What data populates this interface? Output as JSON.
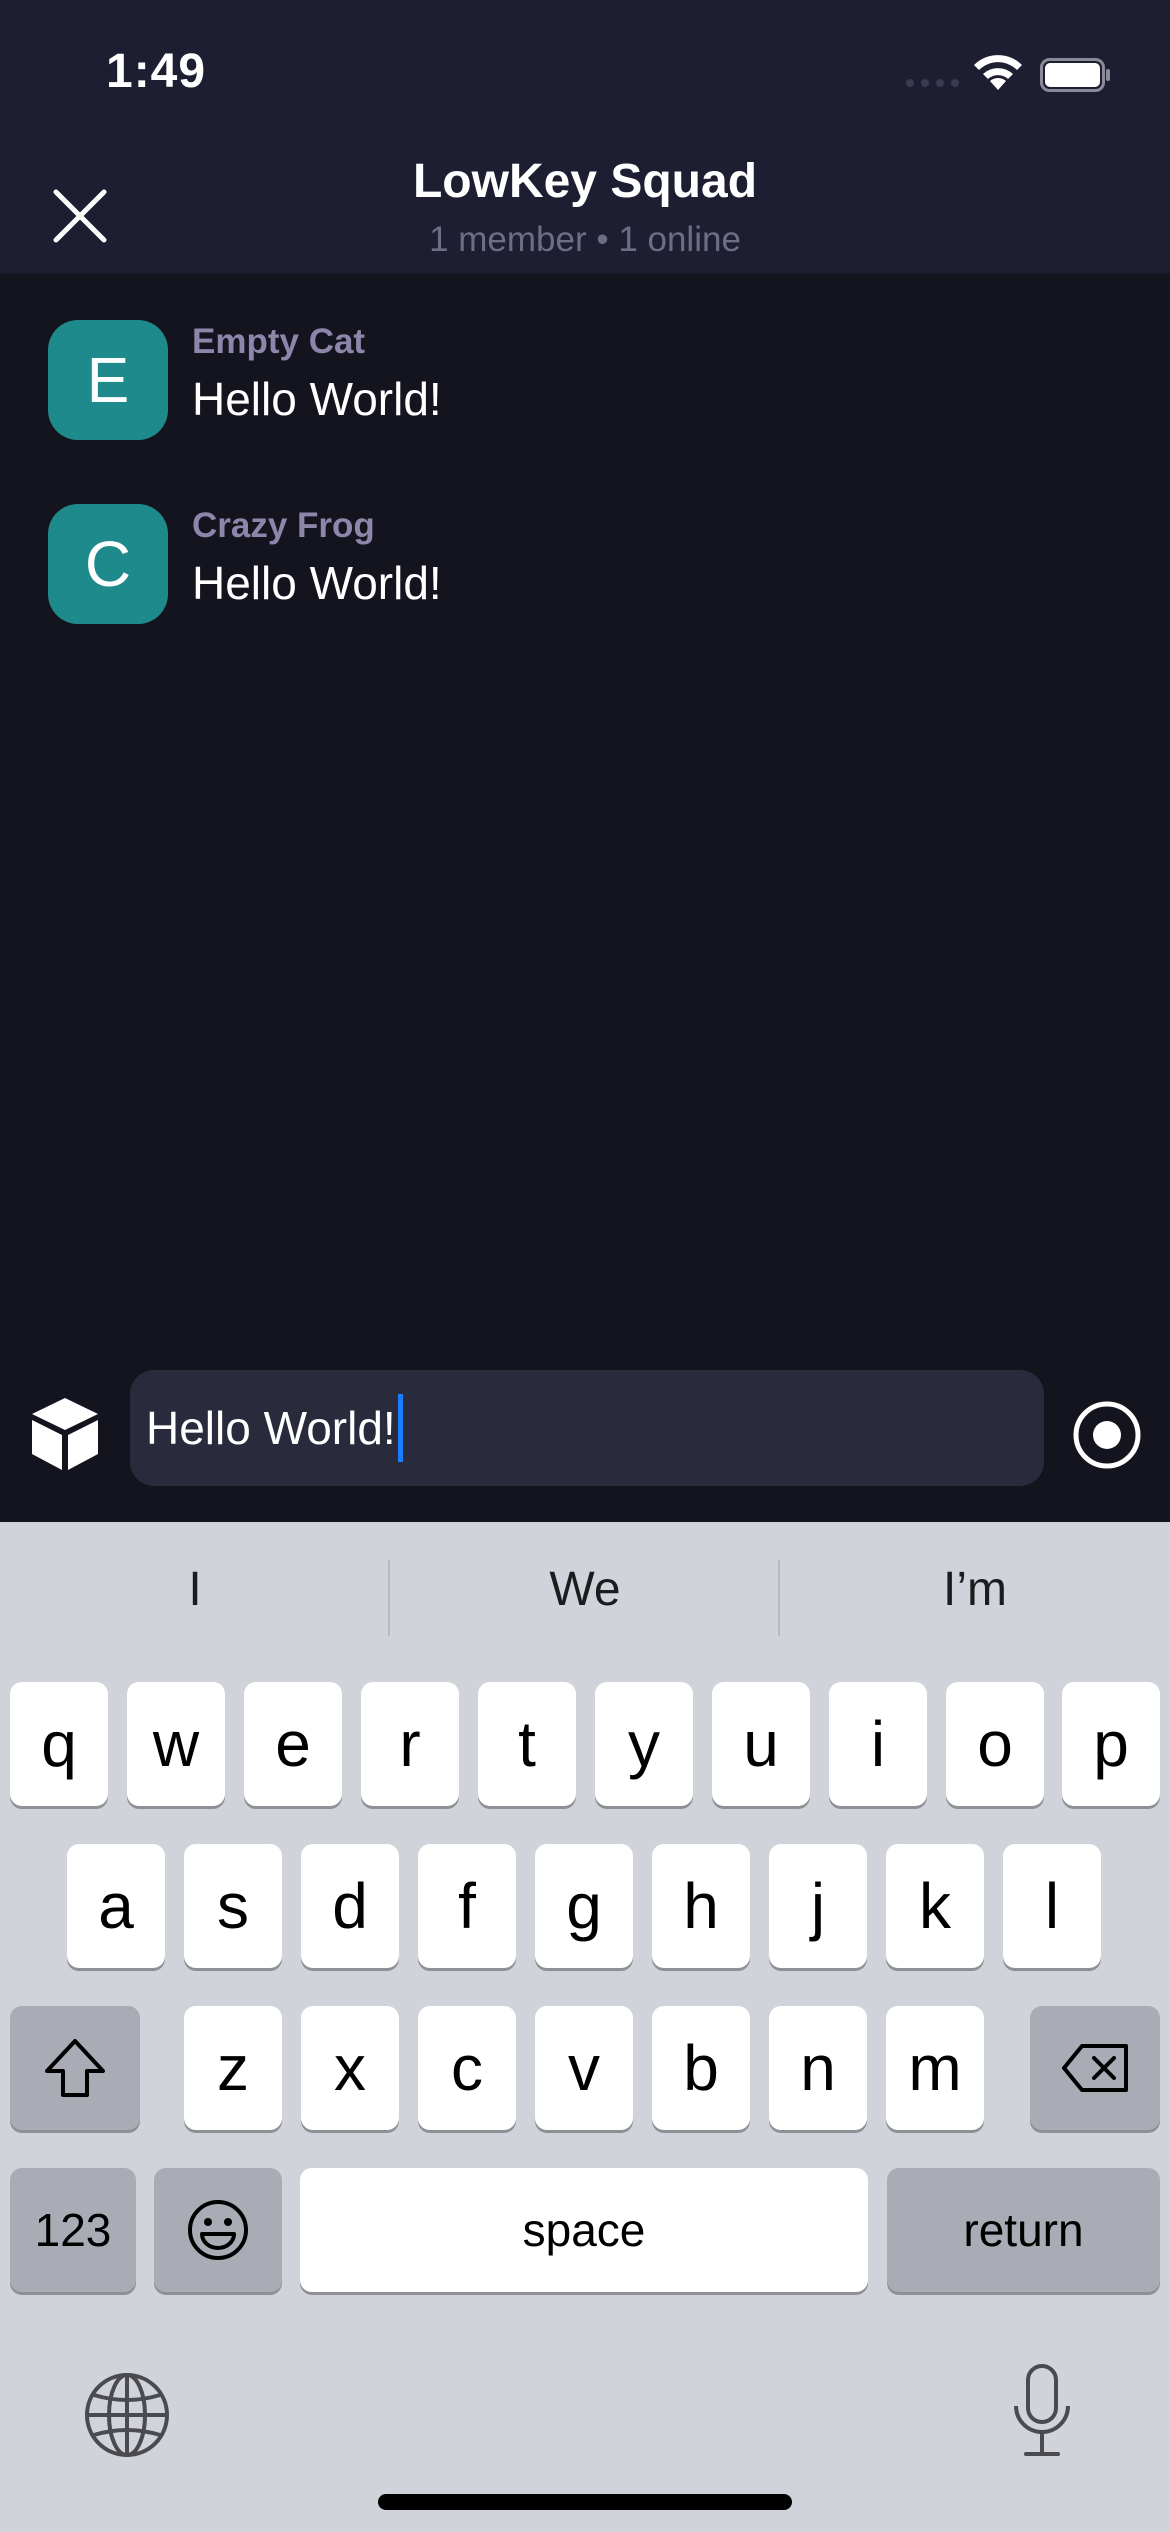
{
  "status_bar": {
    "time": "1:49"
  },
  "header": {
    "title": "LowKey Squad",
    "subtitle": "1 member • 1 online"
  },
  "messages": [
    {
      "initial": "E",
      "sender": "Empty Cat",
      "text": "Hello World!"
    },
    {
      "initial": "C",
      "sender": "Crazy Frog",
      "text": "Hello World!"
    }
  ],
  "composer": {
    "value": "Hello World!"
  },
  "keyboard": {
    "suggestions": [
      "I",
      "We",
      "I’m"
    ],
    "row1": [
      "q",
      "w",
      "e",
      "r",
      "t",
      "y",
      "u",
      "i",
      "o",
      "p"
    ],
    "row2": [
      "a",
      "s",
      "d",
      "f",
      "g",
      "h",
      "j",
      "k",
      "l"
    ],
    "row3": [
      "z",
      "x",
      "c",
      "v",
      "b",
      "n",
      "m"
    ],
    "numbers_label": "123",
    "space_label": "space",
    "return_label": "return"
  },
  "colors": {
    "accent": "#1f8a8c",
    "header_bg": "#1e1e32",
    "chat_bg": "#14141f",
    "caret": "#1a7cff"
  },
  "icons": [
    "close-icon",
    "cube-icon",
    "record-icon",
    "shift-icon",
    "backspace-icon",
    "emoji-icon",
    "globe-icon",
    "microphone-icon"
  ]
}
